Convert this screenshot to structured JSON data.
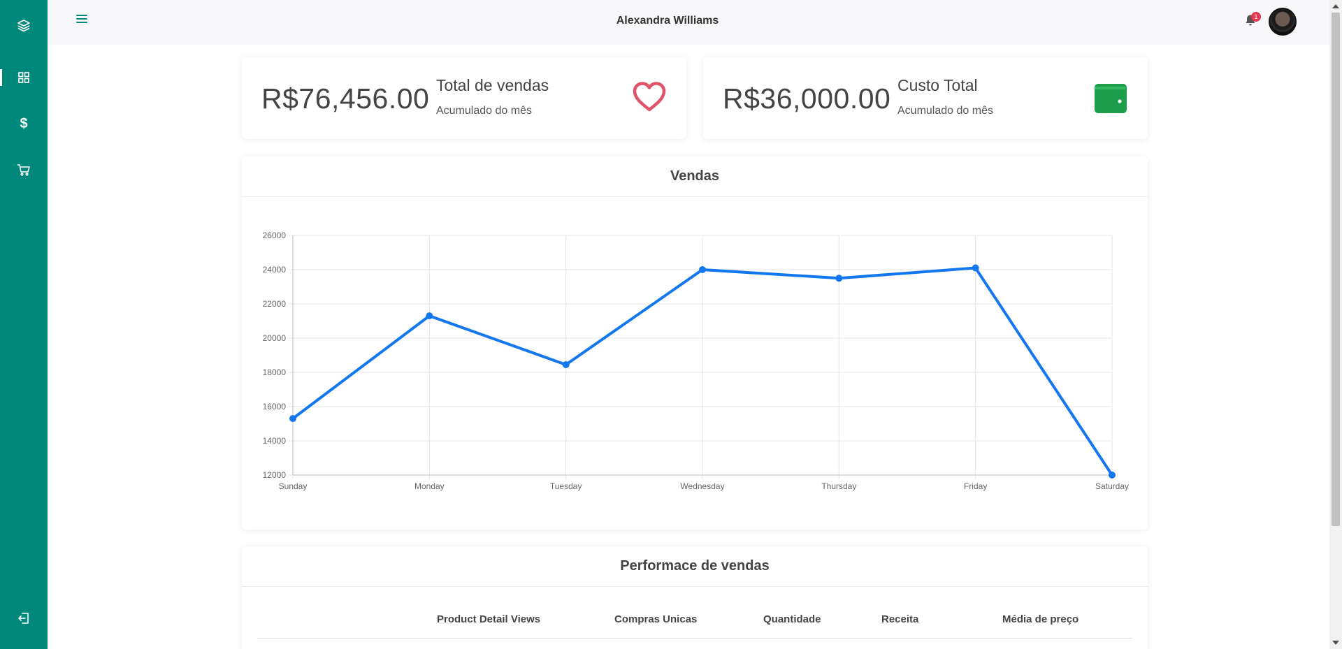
{
  "app": {
    "user_name": "Alexandra Williams",
    "notification_count": "1"
  },
  "sidebar": {
    "items": [
      {
        "icon": "layers-icon",
        "name": "logo"
      },
      {
        "icon": "grid-icon",
        "name": "dashboard",
        "active": true
      },
      {
        "icon": "dollar-icon",
        "name": "finance"
      },
      {
        "icon": "cart-icon",
        "name": "shop"
      }
    ],
    "logout_icon": "logout-icon",
    "color": "#00897b"
  },
  "stats": [
    {
      "value": "R$76,456.00",
      "title": "Total de vendas",
      "subtitle": "Acumulado do mês",
      "icon": "heart-icon",
      "icon_color": "#e0546a"
    },
    {
      "value": "R$36,000.00",
      "title": "Custo Total",
      "subtitle": "Acumulado do mês",
      "icon": "wallet-icon",
      "icon_color": "#1e9e4a"
    }
  ],
  "sales_card": {
    "title": "Vendas"
  },
  "chart_data": {
    "type": "line",
    "categories": [
      "Sunday",
      "Monday",
      "Tuesday",
      "Wednesday",
      "Thursday",
      "Friday",
      "Saturday"
    ],
    "series": [
      {
        "values": [
          15300,
          21300,
          18450,
          24000,
          23500,
          24100,
          12000
        ],
        "color": "#1378ef"
      }
    ],
    "ylim": [
      12000,
      26000
    ],
    "yticks": [
      12000,
      14000,
      16000,
      18000,
      20000,
      22000,
      24000,
      26000
    ],
    "grid": true,
    "legend": "none"
  },
  "performance": {
    "title": "Performace de vendas",
    "columns": [
      "Product Detail Views",
      "Compras Unicas",
      "Quantidade",
      "Receita",
      "Média de preço"
    ]
  }
}
